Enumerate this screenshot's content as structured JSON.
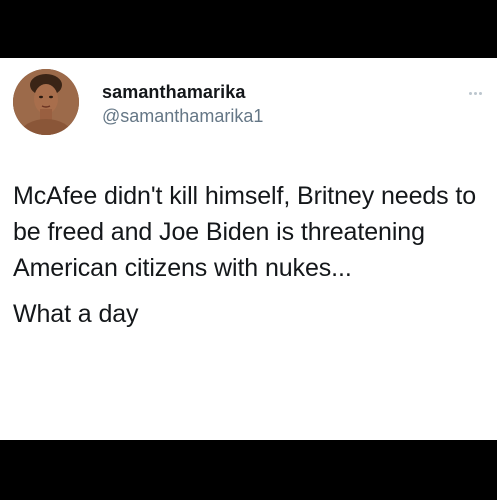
{
  "tweet": {
    "display_name": "samanthamarika",
    "handle": "@samanthamarika1",
    "body": "McAfee didn't kill himself, Britney needs to be freed and Joe Biden is threatening American citizens with nukes...",
    "body_2": "What a day",
    "more_icon": "more-horizontal-icon",
    "avatar_icon": "profile-photo"
  },
  "colors": {
    "background_bars": "#000000",
    "card": "#ffffff",
    "text_primary": "#14171a",
    "text_secondary": "#657786"
  }
}
